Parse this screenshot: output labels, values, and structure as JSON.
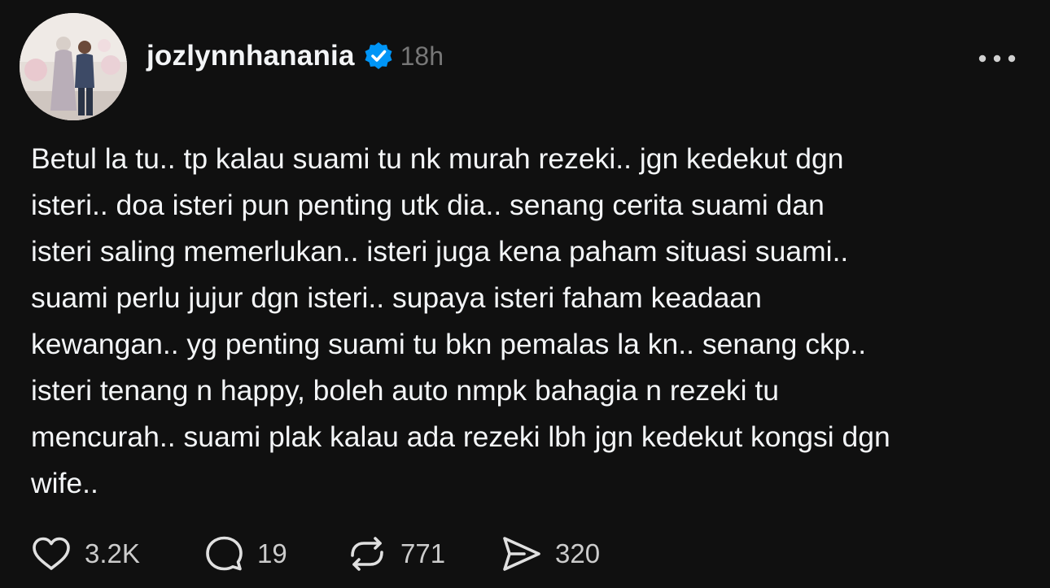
{
  "post": {
    "author": {
      "username": "jozlynnhanania",
      "verified": true,
      "avatar_icon": "profile-photo"
    },
    "timestamp": "18h",
    "more_icon": "ellipsis-icon",
    "text_lines": [
      "Betul la tu.. tp kalau suami tu nk murah rezeki.. jgn kedekut dgn",
      "isteri.. doa isteri pun penting utk dia.. senang cerita suami dan",
      "isteri saling memerlukan.. isteri juga kena paham situasi suami..",
      "suami perlu jujur dgn isteri.. supaya isteri faham keadaan",
      "kewangan.. yg penting suami tu bkn pemalas la kn.. senang ckp..",
      "isteri tenang n happy, boleh auto nmpk bahagia n rezeki tu",
      "mencurah.. suami plak kalau ada rezeki lbh jgn kedekut kongsi dgn",
      "wife.."
    ],
    "actions": {
      "likes": "3.2K",
      "replies": "19",
      "reposts": "771",
      "shares": "320"
    }
  },
  "colors": {
    "background": "#101010",
    "text": "#f3f5f7",
    "muted": "#777777",
    "verified_badge": "#0095f6"
  }
}
